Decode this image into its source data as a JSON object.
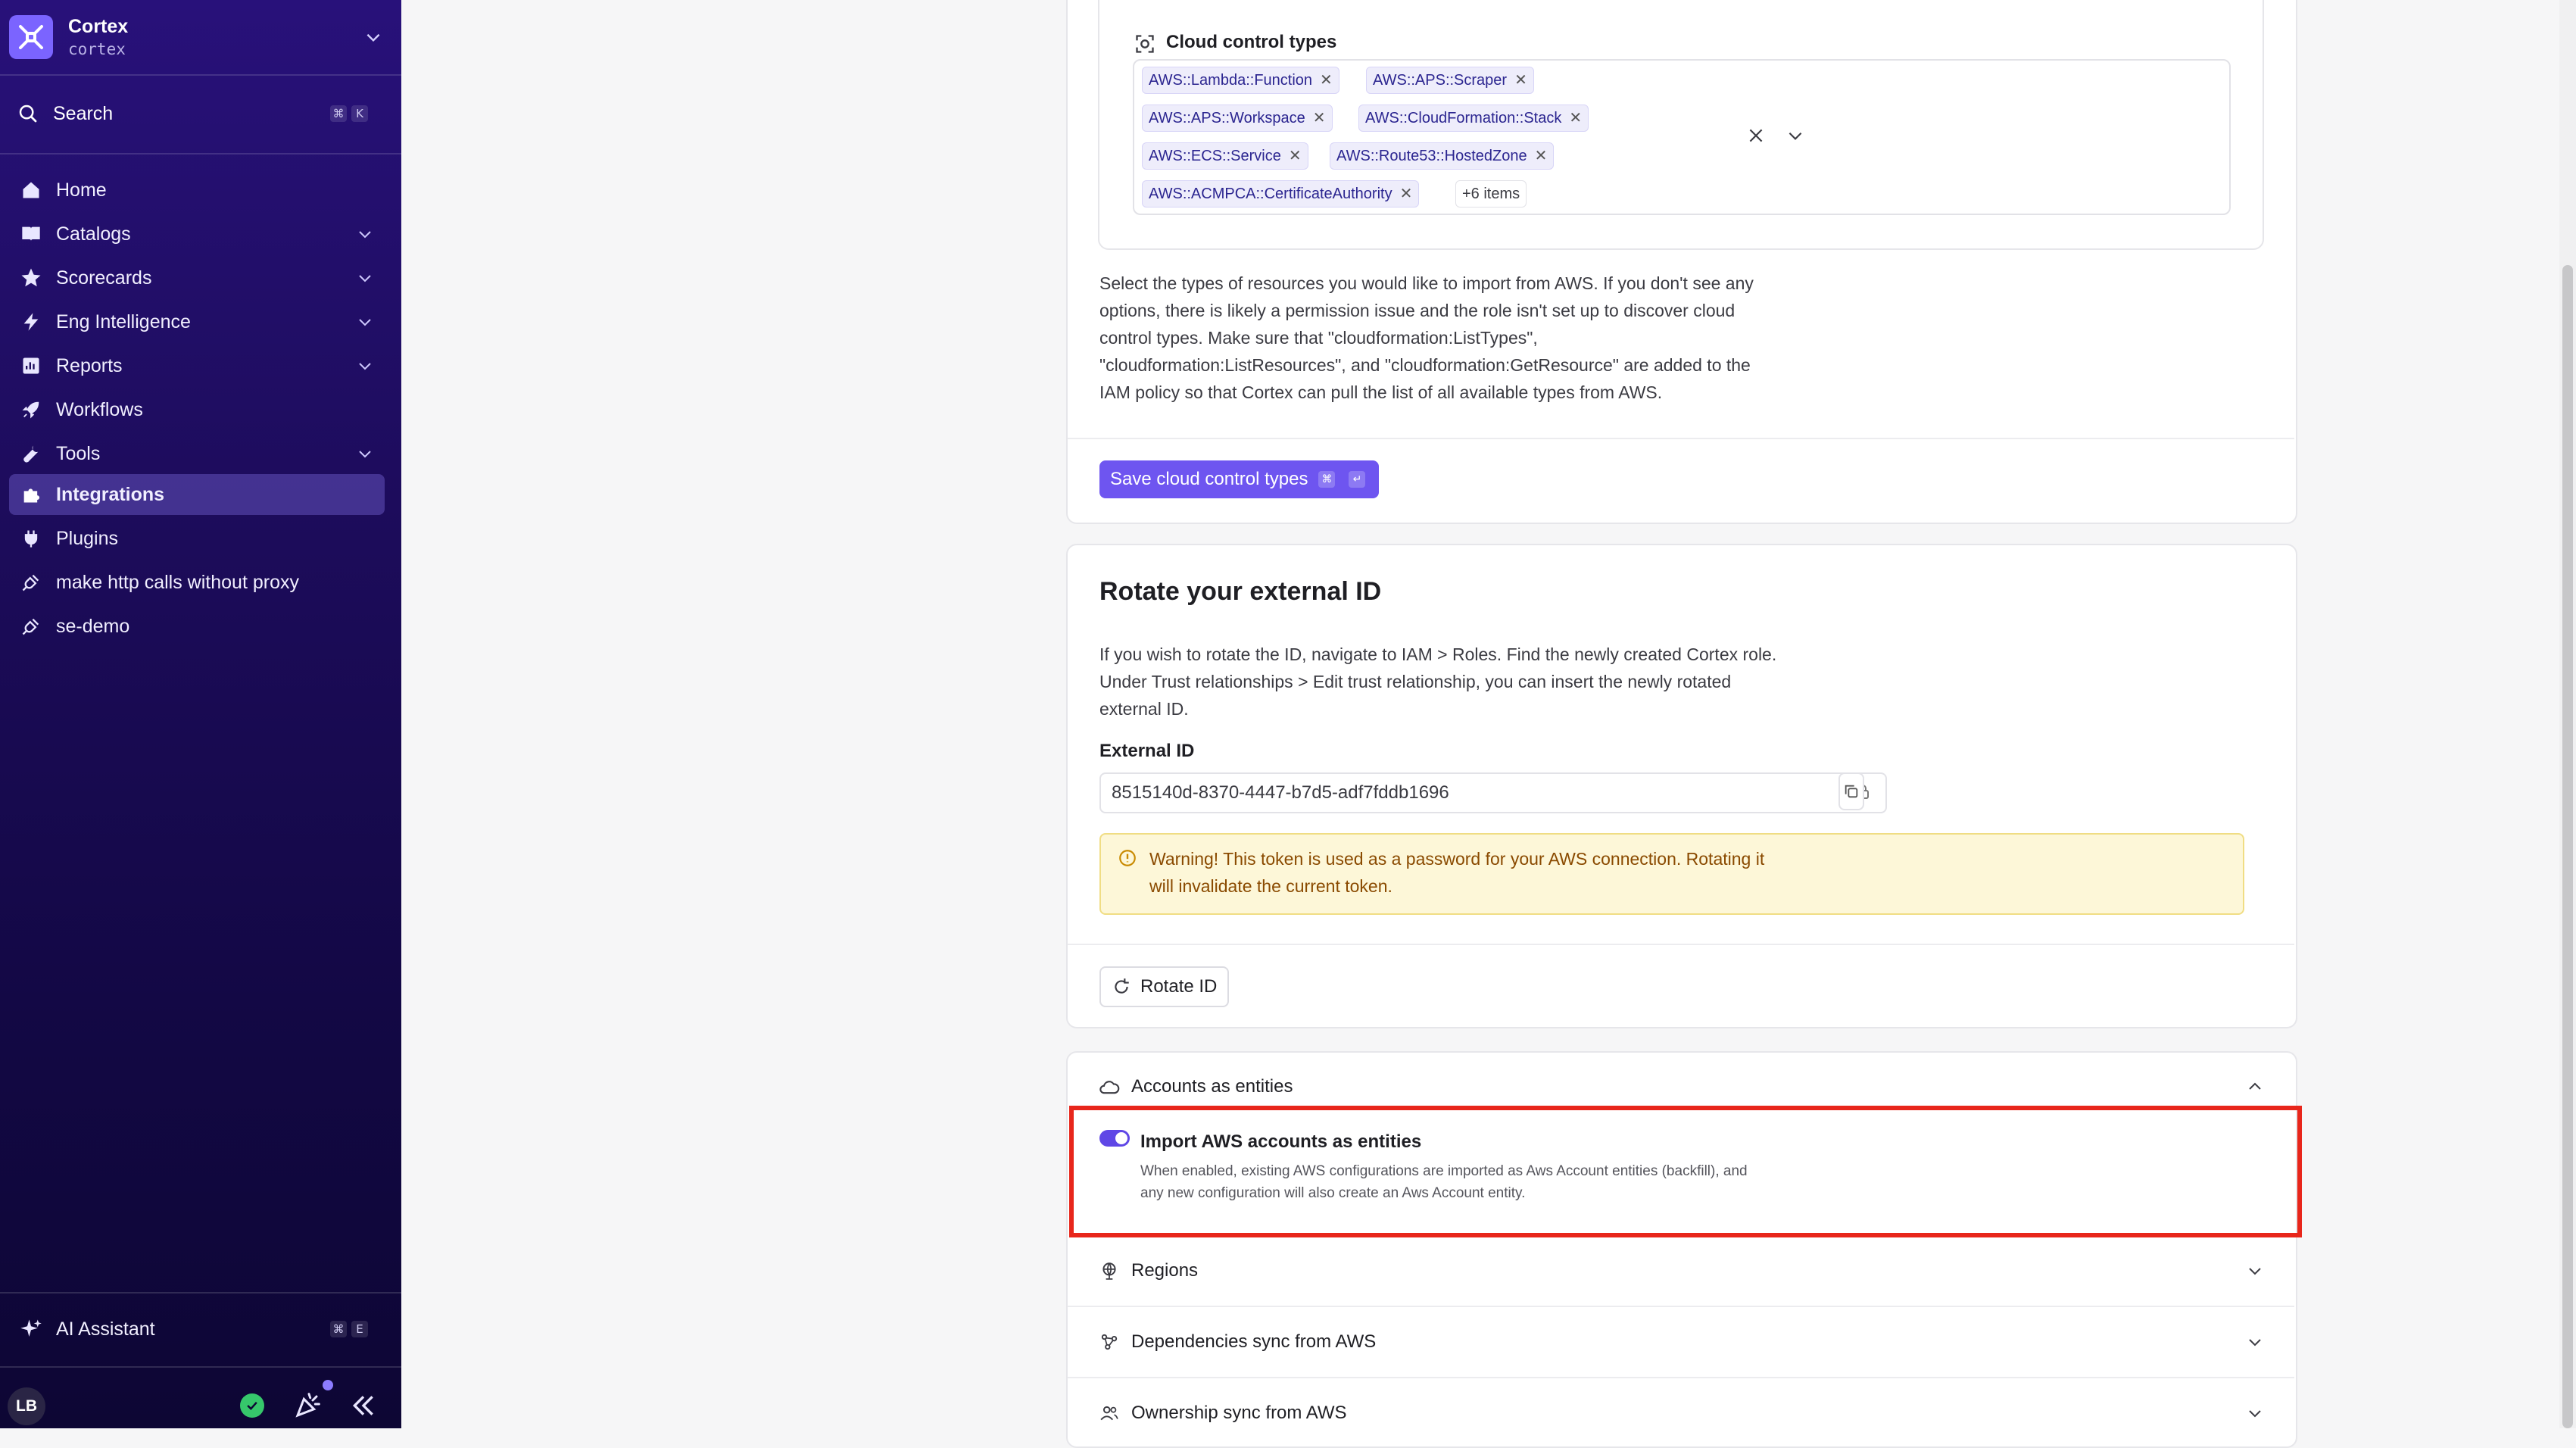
{
  "workspace": {
    "name": "Cortex",
    "slug": "cortex"
  },
  "search": {
    "label": "Search",
    "shortcut": [
      "⌘",
      "K"
    ]
  },
  "nav": [
    {
      "label": "Home",
      "icon": "home-icon"
    },
    {
      "label": "Catalogs",
      "icon": "book-icon"
    },
    {
      "label": "Scorecards",
      "icon": "star-icon"
    },
    {
      "label": "Eng Intelligence",
      "icon": "bolt-icon"
    },
    {
      "label": "Reports",
      "icon": "reports-icon"
    },
    {
      "label": "Workflows",
      "icon": "rocket-icon"
    },
    {
      "label": "Tools",
      "icon": "wrench-icon"
    },
    {
      "label": "Integrations",
      "icon": "puzzle-icon"
    },
    {
      "label": "Plugins",
      "icon": "plug-icon"
    },
    {
      "label": "make http calls without proxy",
      "icon": "plug-outline-icon"
    },
    {
      "label": "se-demo",
      "icon": "plug-outline-icon"
    }
  ],
  "ai_assistant": {
    "label": "AI Assistant",
    "shortcut": [
      "⌘",
      "E"
    ]
  },
  "user": {
    "initials": "LB"
  },
  "cloud_control": {
    "label": "Cloud control types",
    "chips": [
      "AWS::Lambda::Function",
      "AWS::APS::Scraper",
      "AWS::APS::Workspace",
      "AWS::CloudFormation::Stack",
      "AWS::ECS::Service",
      "AWS::Route53::HostedZone",
      "AWS::ACMPCA::CertificateAuthority"
    ],
    "more": "+6 items",
    "help_lines": [
      "Select the types of resources you would like to import from AWS. If you don't see any",
      "options, there is likely a permission issue and the role isn't set up to discover cloud",
      "control types. Make sure that \"cloudformation:ListTypes\",",
      "\"cloudformation:ListResources\", and \"cloudformation:GetResource\" are added to the",
      "IAM policy so that Cortex can pull the list of all available types from AWS."
    ],
    "save_label": "Save cloud control types",
    "save_shortcut": [
      "⌘",
      "↵"
    ]
  },
  "rotate": {
    "title": "Rotate your external ID",
    "desc_lines": [
      "If you wish to rotate the ID, navigate to IAM > Roles. Find the newly created Cortex role.",
      "Under Trust relationships > Edit trust relationship, you can insert the newly rotated",
      "external ID."
    ],
    "external_id_label": "External ID",
    "external_id_value": "8515140d-8370-4447-b7d5-adf7fddb1696",
    "warning_lines": [
      "Warning! This token is used as a password for your AWS connection. Rotating it",
      "will invalidate the current token."
    ],
    "rotate_label": "Rotate ID"
  },
  "accounts": {
    "title": "Accounts as entities",
    "toggle_label": "Import AWS accounts as entities",
    "toggle_on": true,
    "toggle_desc_lines": [
      "When enabled, existing AWS configurations are imported as Aws Account entities (backfill), and",
      "any new configuration will also create an Aws Account entity."
    ]
  },
  "sections": [
    {
      "label": "Regions",
      "icon": "globe-icon"
    },
    {
      "label": "Dependencies sync from AWS",
      "icon": "graph-icon"
    },
    {
      "label": "Ownership sync from AWS",
      "icon": "users-icon"
    }
  ],
  "colors": {
    "accent": "#6e55f0",
    "highlight": "#e8261b",
    "warning_bg": "#fdf7d8"
  }
}
